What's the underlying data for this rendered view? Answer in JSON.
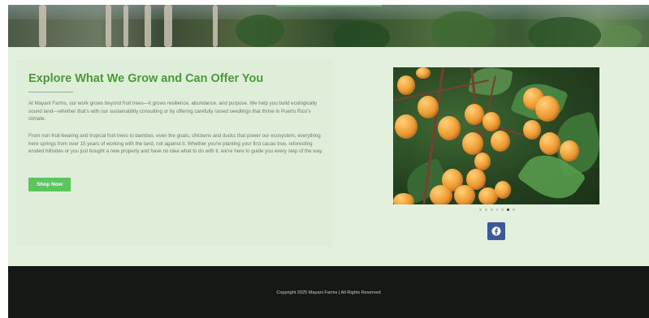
{
  "hero": {
    "image_label": "rainforest-banner"
  },
  "main": {
    "title": "Explore What We Grow and Can Offer You",
    "paragraph_1": "At Mayani Farms, our work grows beyond fruit trees—it grows resilience, abundance, and purpose. We help you build ecologically sound land—whether that's with our sustainability consulting or by offering carefully raised seedlings that thrive in Puerto Rico's climate.",
    "paragraph_2": "From non-fruit-bearing and tropical fruit trees to bamboo, even the goats, chickens and ducks that power our ecosystem, everything here springs from over 15 years of working with the land, not against it. Whether you're planting your first cacao tree, reforesting eroded hillsides or you just bought a new property and have no idea what to do with it, we're here to guide you every step of the way.",
    "shop_button": "Shop Now"
  },
  "carousel": {
    "slide_count": 7,
    "active_index": 5
  },
  "social": {
    "facebook_icon": "facebook-icon",
    "facebook_color": "#3b5998"
  },
  "footer": {
    "copyright": "Copyright 2025 Mayani Farms | All Rights Reserved"
  },
  "colors": {
    "accent_green": "#5ac75c",
    "title_green": "#4a9a3a",
    "band_bg": "#e3f0de",
    "footer_bg": "#161816"
  }
}
